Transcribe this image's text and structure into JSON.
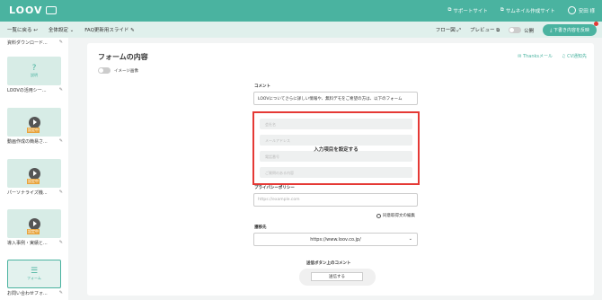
{
  "header": {
    "logo_text": "LOOV",
    "links": [
      "サポートサイト",
      "サムネイル作成サイト"
    ],
    "user_name": "安田 様"
  },
  "subbar": {
    "back_label": "一覧に戻る",
    "settings_label": "全体設定",
    "doc_title": "FAQ更新用スライド",
    "flow_label": "フロー図",
    "preview_label": "プレビュー",
    "public_label": "公開",
    "save_label": "下書き内容を反映"
  },
  "sidebar": {
    "items": [
      {
        "label": "資料ダウンロード..."
      },
      {
        "label": "LOOVの活用シー...",
        "thumb": "?",
        "thumb_caption": "説明"
      },
      {
        "label": "動画作成の簡易さ...",
        "badge": "設定中"
      },
      {
        "label": "パーソナライズ機...",
        "badge": "設定中"
      },
      {
        "label": "導入事例・実績と...",
        "badge": "設定中"
      },
      {
        "label": "お問い合わせフォ...",
        "thumb": "☰",
        "thumb_caption": "フォーム"
      }
    ]
  },
  "main": {
    "title": "フォームの内容",
    "thanks_link": "Thanksメール",
    "cv_link": "CV通知先",
    "image_toggle_label": "イメージ画像",
    "comment_label": "コメント",
    "comment_value": "LOOVについてさらに詳しい情報や、無料デモをご希望の方は、以下のフォーム",
    "form_placeholders": [
      "会社名",
      "メールアドレス",
      "電話番号",
      "ご質問のある内容"
    ],
    "form_center_label": "入力項目を設定する",
    "privacy_label": "プライバシーポリシー",
    "privacy_placeholder": "https://example.com",
    "consent_link": "同意取得文の編集",
    "redirect_label": "遷移先",
    "redirect_value": "https://www.loov.co.jp/",
    "submit_heading": "送信ボタン上のコメント",
    "submit_label": "送信する"
  },
  "colors": {
    "brand": "#4ab3a0",
    "highlight": "#e53935"
  }
}
